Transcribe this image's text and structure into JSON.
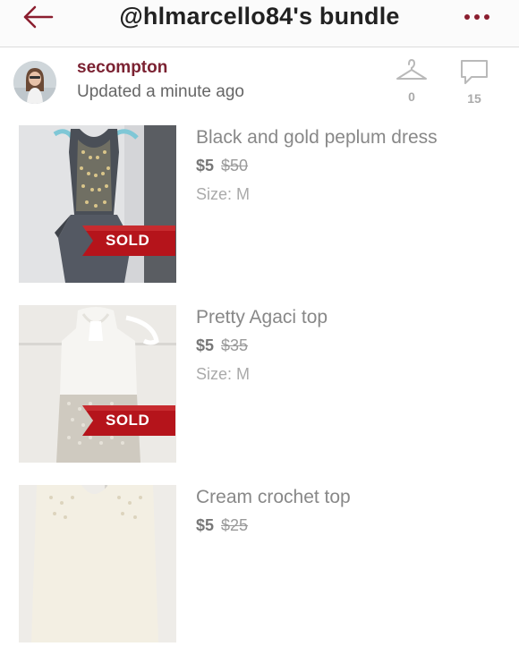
{
  "header": {
    "title": "@hlmarcello84's bundle",
    "back_icon": "back-arrow-icon",
    "more_icon": "more-dots-icon",
    "accent_color": "#8b1e2f"
  },
  "seller": {
    "username": "secompton",
    "updated": "Updated a minute ago",
    "likes": {
      "icon": "hanger-icon",
      "count": "0"
    },
    "comments": {
      "icon": "comment-icon",
      "count": "15"
    }
  },
  "items": [
    {
      "title": "Black and gold peplum dress",
      "price": "$5",
      "original_price": "$50",
      "size": "Size: M",
      "badge": "SOLD"
    },
    {
      "title": "Pretty Agaci top",
      "price": "$5",
      "original_price": "$35",
      "size": "Size: M",
      "badge": "SOLD"
    },
    {
      "title": "Cream crochet top",
      "price": "$5",
      "original_price": "$25"
    }
  ]
}
